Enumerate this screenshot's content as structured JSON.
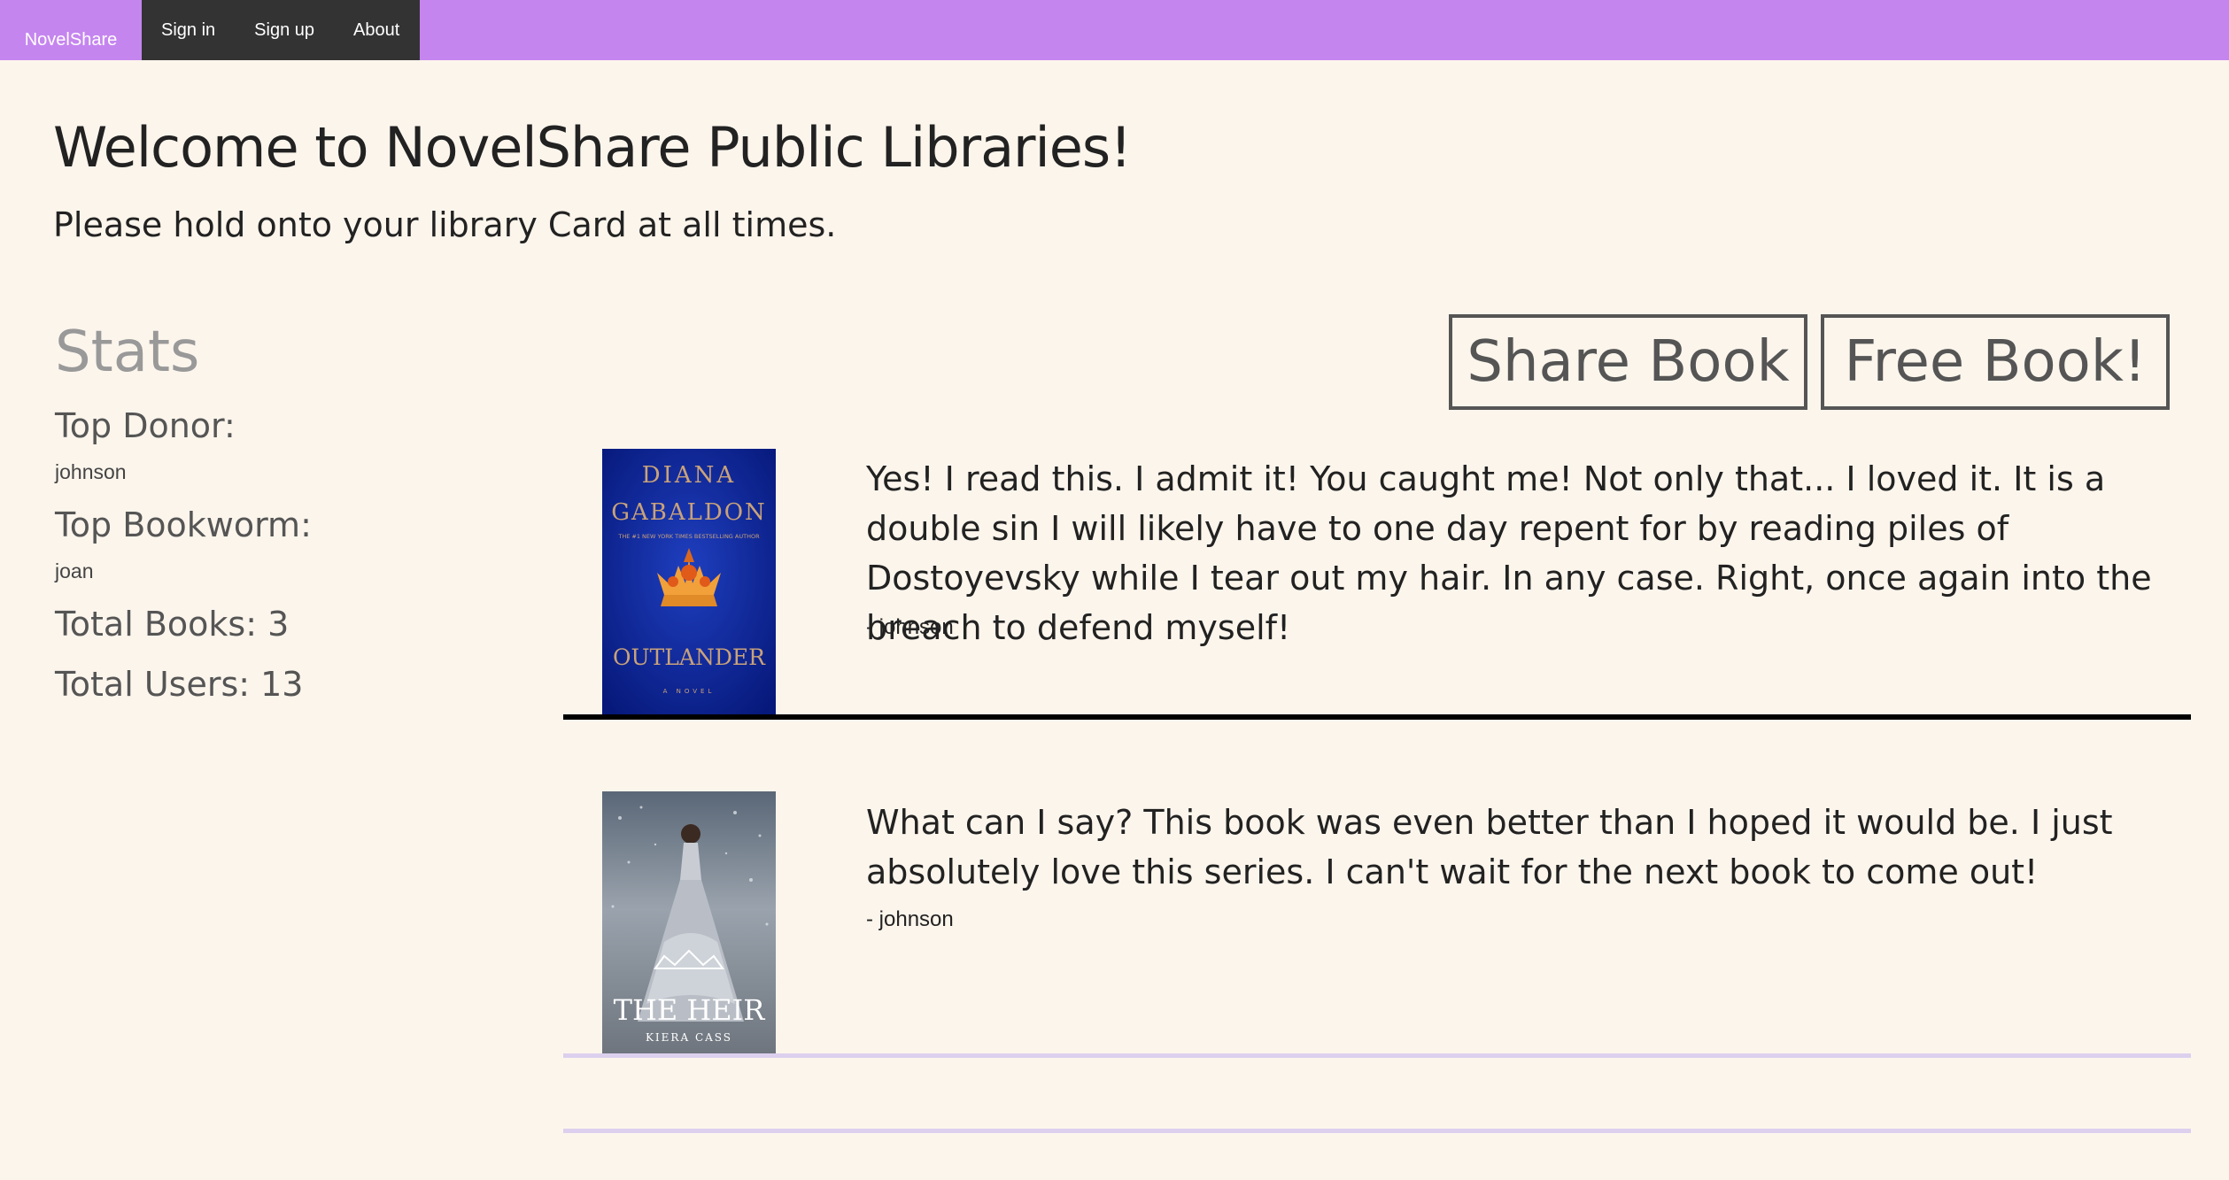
{
  "nav": {
    "brand": "NovelShare",
    "links": [
      {
        "label": "Sign in"
      },
      {
        "label": "Sign up"
      },
      {
        "label": "About"
      }
    ]
  },
  "colors": {
    "navbar": "#c585ef",
    "nav_links_bg": "#333333",
    "page_bg": "#fcf5ec",
    "strong_divider": "#000000",
    "light_divider": "#dcd0ee"
  },
  "hero": {
    "title": "Welcome to NovelShare Public Libraries!",
    "subtitle": "Please hold onto your library Card at all times."
  },
  "stats": {
    "heading": "Stats",
    "top_donor_label": "Top Donor:",
    "top_donor": "johnson",
    "top_bookworm_label": "Top Bookworm:",
    "top_bookworm": "joan",
    "total_books": "Total Books: 3",
    "total_users": "Total Users: 13"
  },
  "actions": {
    "share_label": "Share Book",
    "free_label": "Free Book!"
  },
  "posts": [
    {
      "cover": {
        "author": "DIANA GABALDON",
        "tagline": "THE #1 NEW YORK TIMES BESTSELLING AUTHOR",
        "title": "OUTLANDER",
        "subtitle": "A NOVEL",
        "icon": "thistle-crown-icon"
      },
      "review": "Yes! I read this. I admit it! You caught me! Not only that... I loved it. It is a double sin I will likely have to one day repent for by reading piles of Dostoyevsky while I tear out my hair. In any case. Right, once again into the breach to defend myself!",
      "author": "- johnson"
    },
    {
      "cover": {
        "title": "THE HEIR",
        "author": "KIERA CASS",
        "icon": "gown-figure-icon"
      },
      "review": "What can I say? This book was even better than I hoped it would be. I just absolutely love this series. I can't wait for the next book to come out!",
      "author": "- johnson"
    }
  ]
}
